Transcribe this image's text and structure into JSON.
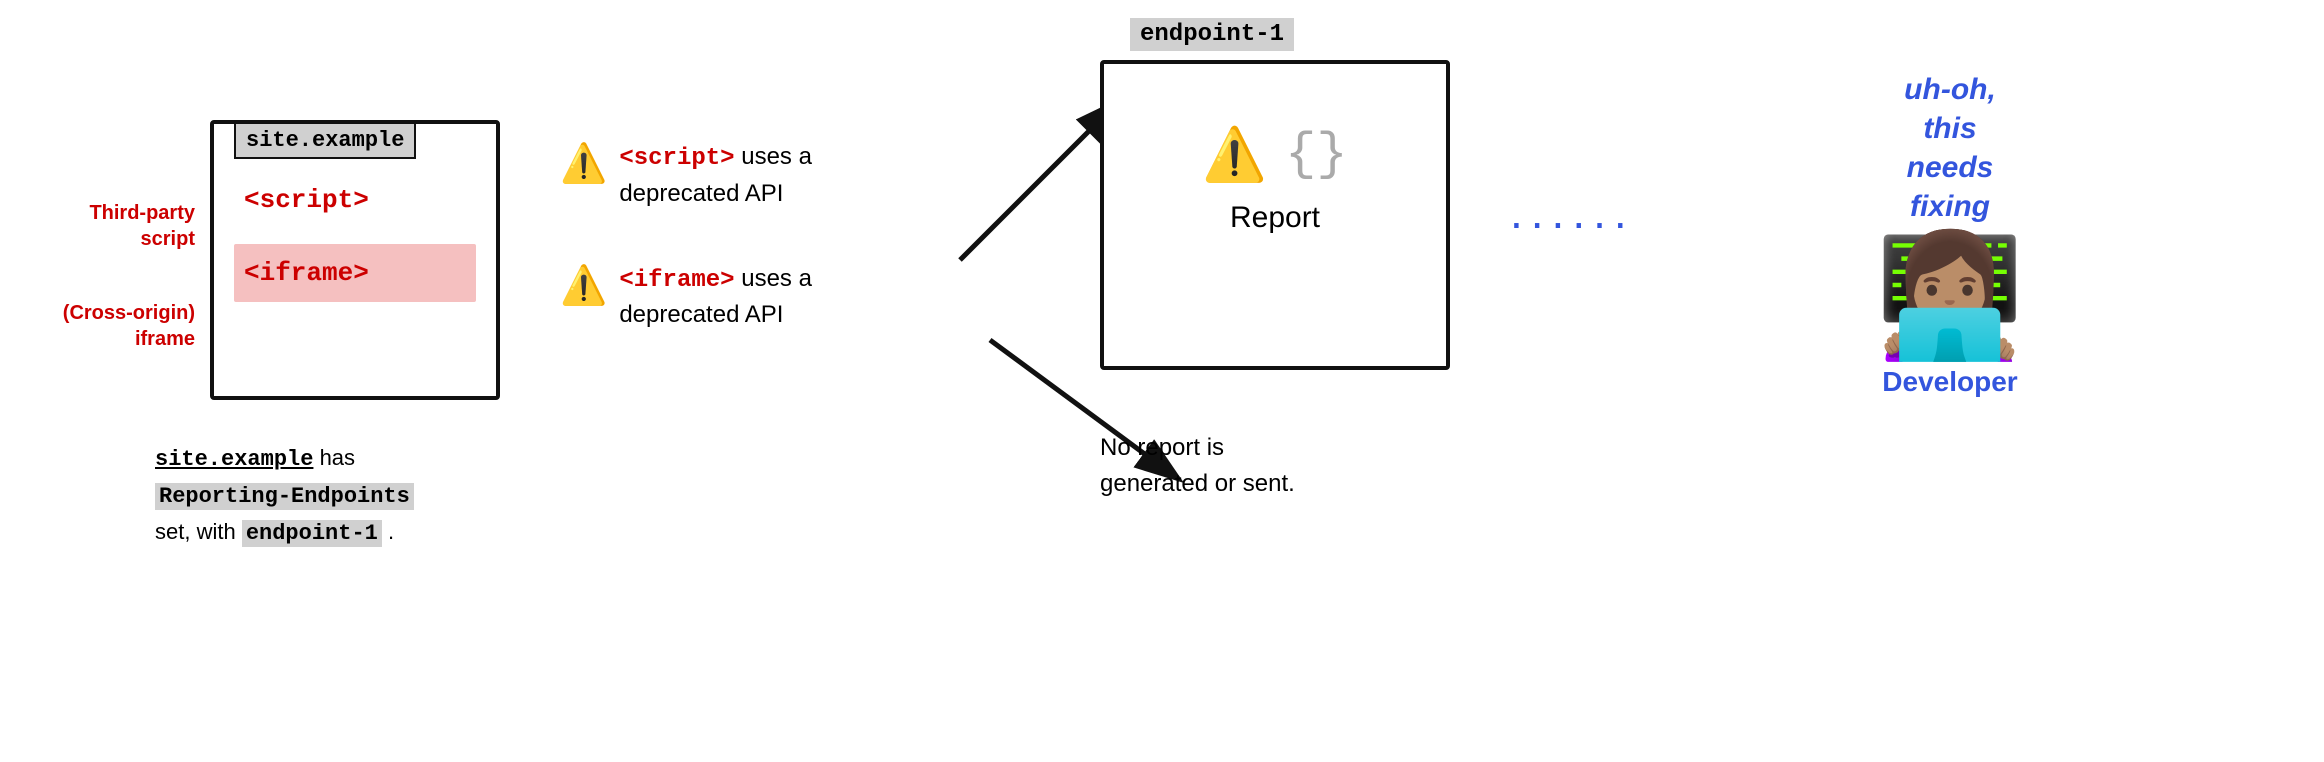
{
  "site_box": {
    "title": "site.example",
    "script_tag": "<script>",
    "iframe_tag": "<iframe>"
  },
  "labels": {
    "third_party": "Third-party\nscript",
    "cross_origin": "(Cross-origin)\niframe"
  },
  "bottom_text": {
    "mono_underline": "site.example",
    "text1": " has",
    "bg1": "Reporting-Endpoints",
    "text2": "set, with",
    "bg2": "endpoint-1",
    "text3": "."
  },
  "notices": [
    {
      "icon": "⚠️",
      "text_part1": "",
      "red": "<script>",
      "text_part2": " uses a\ndeprecated API"
    },
    {
      "icon": "⚠️",
      "text_part1": "",
      "red": "<iframe>",
      "text_part2": " uses a\ndeprecated API"
    }
  ],
  "endpoint": {
    "label": "endpoint-1",
    "warn_icon": "⚠️",
    "braces": "{}",
    "report_label": "Report"
  },
  "no_report": "No report is\ngenerated or sent.",
  "dots": "......",
  "developer": {
    "speech": "uh-oh,\nthis\nneeds\nfixing",
    "emoji": "👩🏽‍💻",
    "label": "Developer"
  }
}
